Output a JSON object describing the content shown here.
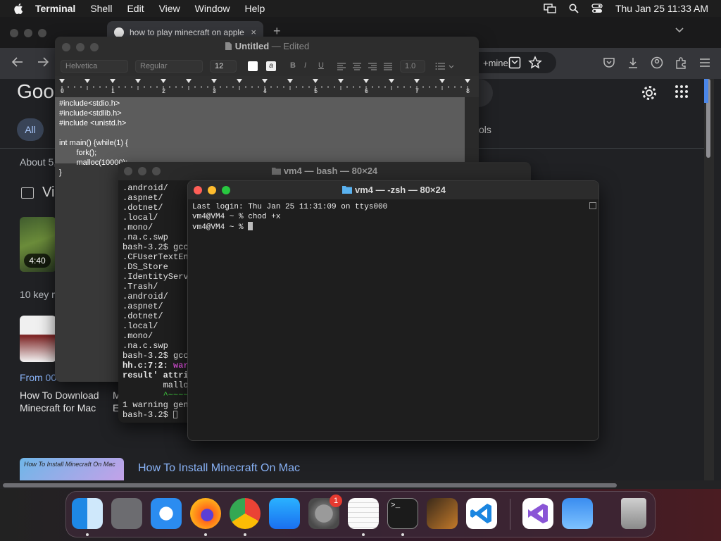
{
  "menubar": {
    "app": "Terminal",
    "items": [
      "Shell",
      "Edit",
      "View",
      "Window",
      "Help"
    ],
    "clock": "Thu Jan 25  11:33 AM"
  },
  "browser": {
    "tab_title": "how to play minecraft on apple",
    "tab_close": "×",
    "new_tab": "+",
    "omnibox_tail": "+mine",
    "google": {
      "logo": "Goo",
      "all_tab": "All",
      "tools_tab": "ols",
      "about": "About 5,",
      "videos_heading": "Vi",
      "video_duration": "4:40",
      "key_moments": "10 key m",
      "from": "From 00",
      "result1_title": "How To Download\nMinecraft for Mac",
      "result1_frag": "M\nE",
      "result2_thumb": "How To Install Minecraft On Mac",
      "result2_title": "How To Install Minecraft On Mac"
    }
  },
  "textedit": {
    "title": "Untitled",
    "title_suffix": " — Edited",
    "font": "Helvetica",
    "style": "Regular",
    "size": "12",
    "spacing": "1.0",
    "ruler_numbers": [
      "0",
      "1",
      "2",
      "3",
      "4",
      "5",
      "6",
      "7",
      "8"
    ],
    "code": "#include<stdio.h>\n#include<stdlib.h>\n#include <unistd.h>\n\nint main() {while(1) {\n        fork();\n        malloc(10000);\n}"
  },
  "bash": {
    "title": "vm4 — bash — 80×24",
    "lines": [
      ".android/",
      ".aspnet/",
      ".dotnet/",
      ".local/",
      ".mono/",
      ".na.c.swp",
      "bash-3.2$ gcc",
      ".CFUserTextEn",
      ".DS_Store",
      ".IdentityServ",
      ".Trash/",
      ".android/",
      ".aspnet/",
      ".dotnet/",
      ".local/",
      ".mono/",
      ".na.c.swp",
      "bash-3.2$ gcc",
      "hh.c:7:2: war",
      "result' attri",
      "        mallo",
      "        ^~~~~",
      "1 warning gen",
      "bash-3.2$ "
    ]
  },
  "zsh": {
    "title": "vm4 — -zsh — 80×24",
    "lines": [
      "Last login: Thu Jan 25 11:31:09 on ttys000",
      "vm4@VM4 ~ % chod +x",
      "vm4@VM4 ~ % "
    ]
  },
  "dock": {
    "apps": [
      "Finder",
      "Launchpad",
      "Safari",
      "Firefox",
      "Chrome",
      "App Store",
      "System Settings",
      "TextEdit",
      "Terminal",
      "GarageBand",
      "Visual Studio Code",
      "Visual Studio",
      "Weather",
      "Trash"
    ],
    "settings_badge": "1"
  }
}
